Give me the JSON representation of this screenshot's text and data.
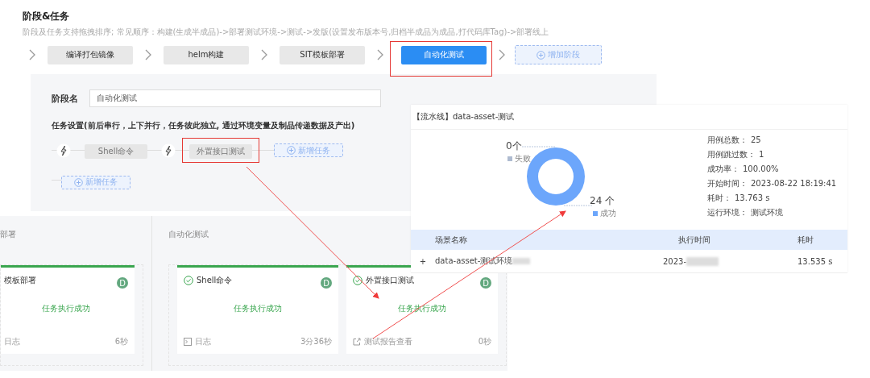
{
  "header": {
    "title": "阶段&任务",
    "hint": "阶段及任务支持拖拽排序; 常见顺序：构建(生成半成品)->部署测试环境->测试->发版(设置发布版本号,归档半成品为成品,打代码库Tag)->部署线上"
  },
  "stages": [
    {
      "label": "编译打包镜像",
      "selected": false,
      "highlighted": false
    },
    {
      "label": "helm构建",
      "selected": false,
      "highlighted": false
    },
    {
      "label": "SIT模板部署",
      "selected": false,
      "highlighted": false
    },
    {
      "label": "自动化测试",
      "selected": true,
      "highlighted": true
    }
  ],
  "add_stage": "增加阶段",
  "stage_form": {
    "name_label": "阶段名",
    "name_value": "自动化测试",
    "tasks_title": "任务设置(前后串行，上下并行，任务彼此独立, 通过环境变量及制品传递数据及产出)",
    "task_rows": [
      [
        {
          "kind": "task",
          "label": "Shell命令",
          "highlighted": false
        },
        {
          "kind": "task",
          "label": "外置接口测试",
          "highlighted": true
        },
        {
          "kind": "add",
          "label": "新增任务"
        }
      ],
      [
        {
          "kind": "add",
          "label": "新增任务"
        }
      ]
    ]
  },
  "runs": [
    {
      "title": "部署",
      "cards": [
        {
          "title": "模板部署",
          "check": false,
          "badge": "D",
          "status": "任务执行成功",
          "footer": {
            "kind": "text",
            "label": "日志"
          },
          "duration": "6秒"
        }
      ]
    },
    {
      "title": "自动化测试",
      "cards": [
        {
          "title": "Shell命令",
          "check": true,
          "badge": "D",
          "status": "任务执行成功",
          "footer": {
            "kind": "log",
            "label": "日志"
          },
          "duration": "3分36秒"
        },
        {
          "title": "外置接口测试",
          "check": true,
          "badge": "D",
          "status": "任务执行成功",
          "footer": {
            "kind": "link",
            "label": "测试报告查看"
          },
          "duration": "0秒"
        }
      ]
    }
  ],
  "report": {
    "title": "【流水线】data-asset-测试",
    "chart_data": {
      "type": "donut",
      "categories": [
        "失败",
        "成功"
      ],
      "values": [
        0,
        24
      ],
      "colors": [
        "#aebbd0",
        "#6ca6fb"
      ],
      "value_labels": [
        "0个",
        "24 个"
      ]
    },
    "stats": [
      {
        "label": "用例总数：",
        "value": "25"
      },
      {
        "label": "用例跳过数：",
        "value": "1"
      },
      {
        "label": "成功率：",
        "value": "100.00%"
      },
      {
        "label": "开始时间：",
        "value": "2023-08-22 18:19:41"
      },
      {
        "label": "耗时：",
        "value": "13.763 s"
      },
      {
        "label": "运行环境：",
        "value": "测试环境"
      }
    ],
    "table": {
      "columns": [
        "场景名称",
        "执行时间",
        "耗时"
      ],
      "rows": [
        {
          "expand": "+",
          "name": "data-asset-测试环境",
          "time": "2023-",
          "duration": "13.535 s",
          "redacted": true
        }
      ]
    }
  }
}
